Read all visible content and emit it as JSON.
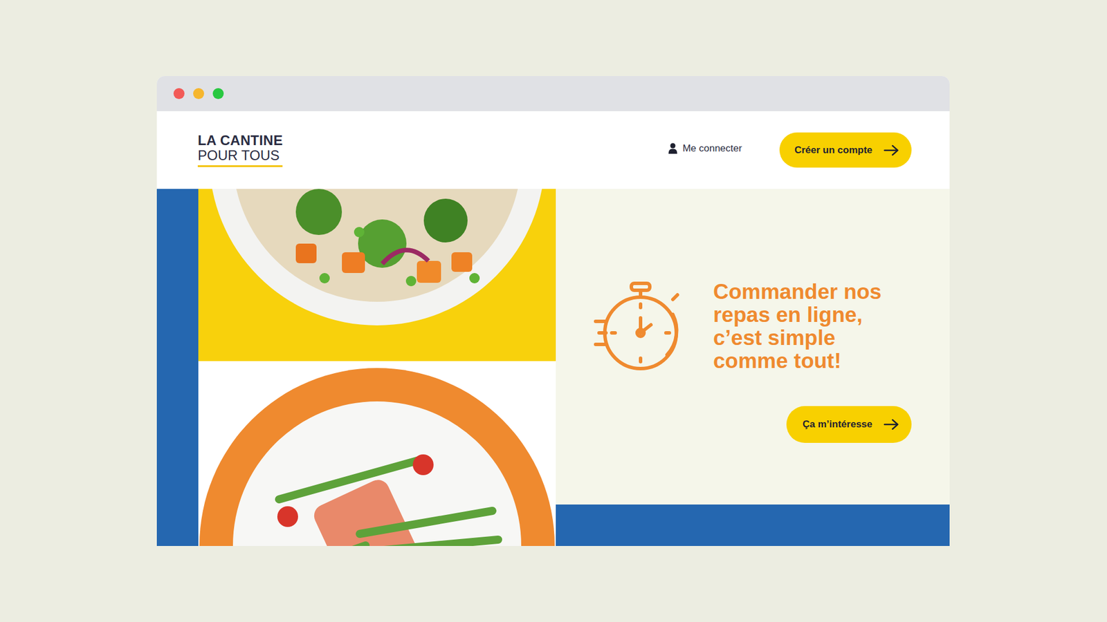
{
  "logo": {
    "line1": "LA CANTINE",
    "line2": "POUR TOUS"
  },
  "header": {
    "login": "Me connecter",
    "signup": "Créer un compte"
  },
  "hero": {
    "headline": [
      "Commander nos",
      "repas en ligne,",
      "c’est simple",
      "comme tout!"
    ],
    "cta": "Ça m’intéresse"
  }
}
